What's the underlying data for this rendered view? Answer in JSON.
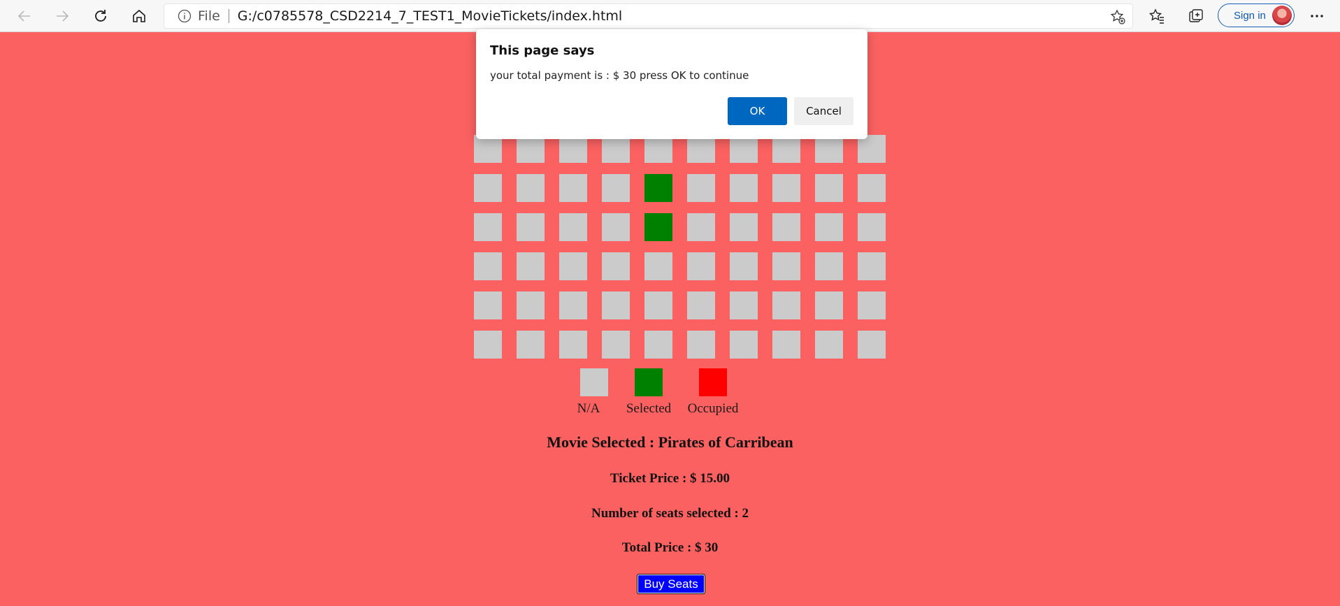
{
  "browser": {
    "scheme": "File",
    "url": "G:/c0785578_CSD2214_7_TEST1_MovieTickets/index.html",
    "signin_label": "Sign in"
  },
  "seat_rows": [
    [
      "na",
      "na",
      "na",
      "na",
      "na",
      "na",
      "na",
      "na",
      "na",
      "na"
    ],
    [
      "na",
      "na",
      "na",
      "na",
      "selected",
      "na",
      "na",
      "na",
      "na",
      "na"
    ],
    [
      "na",
      "na",
      "na",
      "na",
      "selected",
      "na",
      "na",
      "na",
      "na",
      "na"
    ],
    [
      "na",
      "na",
      "na",
      "na",
      "na",
      "na",
      "na",
      "na",
      "na",
      "na"
    ],
    [
      "na",
      "na",
      "na",
      "na",
      "na",
      "na",
      "na",
      "na",
      "na",
      "na"
    ],
    [
      "na",
      "na",
      "na",
      "na",
      "na",
      "na",
      "na",
      "na",
      "na",
      "na"
    ]
  ],
  "legend": {
    "na": "N/A",
    "selected": "Selected",
    "occupied": "Occupied"
  },
  "colors": {
    "page_bg": "#fb6161",
    "seat_na": "#cbcbcb",
    "seat_selected": "#008000",
    "seat_occupied": "#ff0000",
    "buy_button": "#0000ff"
  },
  "summary": {
    "movie": "Movie Selected : Pirates of Carribean",
    "ticket_price": "Ticket Price : $ 15.00",
    "seats_selected": "Number of seats selected : 2",
    "total_price": "Total Price : $ 30"
  },
  "buy_button_label": "Buy Seats",
  "dialog": {
    "title": "This page says",
    "message": "your total payment is : $ 30 press OK to continue",
    "ok_label": "OK",
    "cancel_label": "Cancel"
  }
}
